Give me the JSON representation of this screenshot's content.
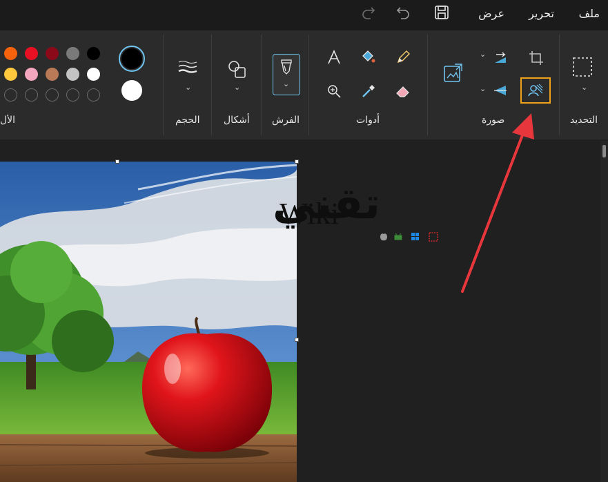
{
  "menu": {
    "file": "ملف",
    "edit": "تحرير",
    "view": "عرض"
  },
  "quick_access": {
    "save_icon": "save-icon",
    "undo_icon": "undo-icon",
    "redo_icon": "redo-icon"
  },
  "ribbon": {
    "selection": {
      "label": "التحديد"
    },
    "image": {
      "label": "صورة"
    },
    "tools": {
      "label": "أدوات"
    },
    "brushes": {
      "label": "الفرش"
    },
    "shapes": {
      "label": "أشكال"
    },
    "size": {
      "label": "الحجم"
    },
    "colors": {
      "label": "الأل",
      "primary": "#000000",
      "secondary": "#ffffff",
      "palette": [
        [
          "#000000",
          "#7a7a7a",
          "#8b0a1a",
          "#e81123",
          "#f7630c"
        ],
        [
          "#ffffff",
          "#c3c3c3",
          "#b97a57",
          "#f4a6bf",
          "#ffc83d"
        ],
        [
          "",
          "",
          "",
          "",
          ""
        ]
      ]
    }
  },
  "watermark": {
    "arabic": "تقني",
    "latin": "Wiki"
  },
  "colors": {
    "highlight": "#f0a11c",
    "arrow": "#e8373c",
    "accent": "#4aa8d8"
  }
}
